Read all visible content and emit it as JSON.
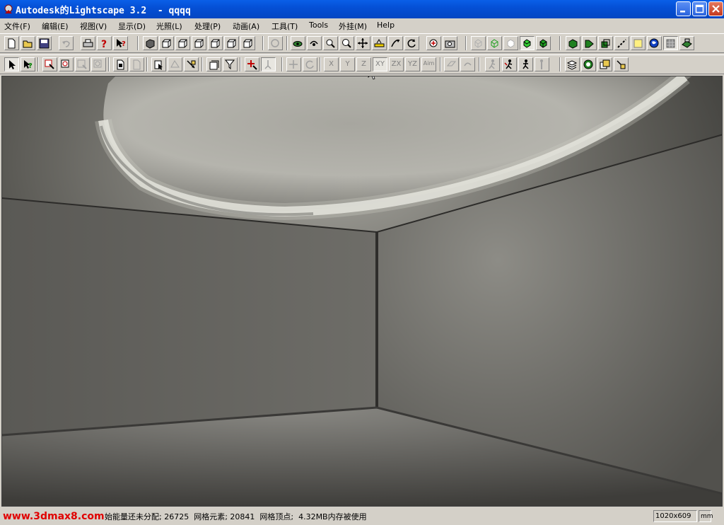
{
  "window": {
    "title": "Autodesk的Lightscape 3.2  - qqqq"
  },
  "menu": [
    "文件(F)",
    "编辑(E)",
    "视图(V)",
    "显示(D)",
    "光照(L)",
    "处理(P)",
    "动画(A)",
    "工具(T)",
    "Tools",
    "外挂(M)",
    "Help"
  ],
  "toolbar2": {
    "axis_labels": [
      "X",
      "Y",
      "Z",
      "XY",
      "ZX",
      "YZ",
      "Aim"
    ]
  },
  "status": {
    "watermark": "www.3dmax8.com",
    "text": "始能量还未分配; 26725  网格元素; 20841  网格顶点;  4.32MB内存被使用",
    "resolution": "1020x609",
    "unit": "mm"
  },
  "colors": {
    "titlebar": "#0550d6",
    "chrome": "#d4d0c8",
    "watermark": "#e00000",
    "selected_shade": "#33cc33"
  }
}
